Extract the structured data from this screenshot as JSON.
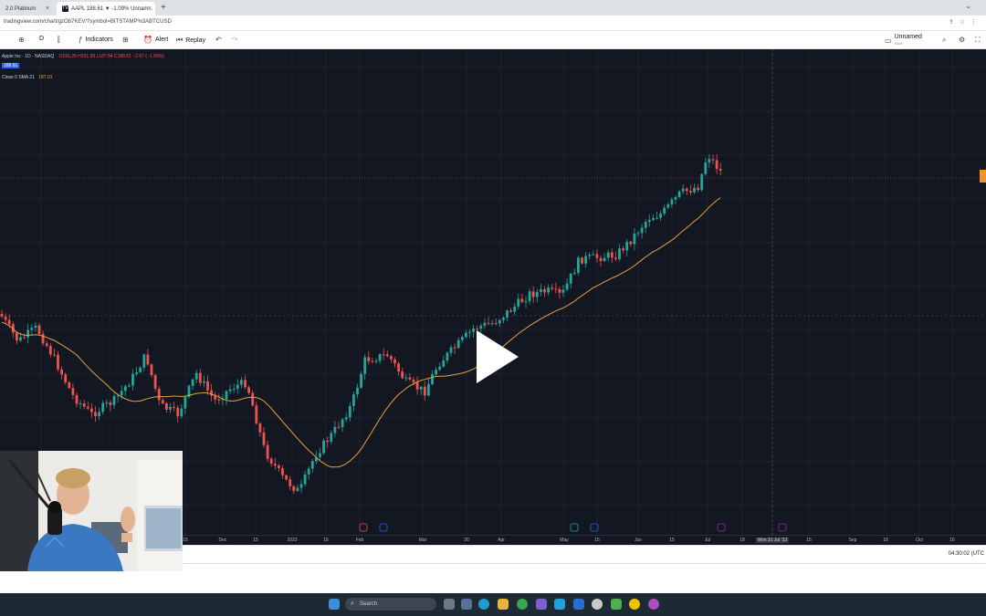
{
  "browser": {
    "tabs": [
      {
        "label": "2.0 Platinum",
        "active": false
      },
      {
        "label": "AAPL 188.61 ▼ -1.09% Unnam...",
        "active": true
      }
    ],
    "new_tab_icon": "plus-icon",
    "url": "tradingview.com/chart/gzOb7KEV/?symbol=BITSTAMP%3ABTCUSD"
  },
  "toolbar": {
    "interval": "D",
    "indicators_label": "Indicators",
    "alert_label": "Alert",
    "replay_label": "Replay",
    "layout_name": "Unnamed",
    "layout_sub": "Save"
  },
  "legend": {
    "symbol": "Apple Inc · 1D · NASDAQ",
    "ohlc": "O191.26 H191.99 L187.54 C188.61 −2.07 (−1.09%)",
    "price_tag": "188.61",
    "sma": "Close 0 SMA 21",
    "sma_value": "187.01"
  },
  "chart_data": {
    "type": "candlestick",
    "title": "",
    "xlabel": "",
    "ylabel": "",
    "x_ticks": [
      "15",
      "Dec",
      "15",
      "2023",
      "16",
      "Feb",
      "Mar",
      "20",
      "Apr",
      "May",
      "15",
      "Jun",
      "15",
      "Jul",
      "18",
      "Mon 31 Jul '23",
      "15",
      "Sep",
      "18",
      "Oct",
      "16"
    ],
    "highlighted_x_tick": "Mon 31 Jul '23",
    "up_color": "#26a69a",
    "down_color": "#ef5350",
    "sma_color": "#e9a13b",
    "series": [
      {
        "name": "Close 0 SMA 21",
        "type": "line"
      }
    ]
  },
  "status": {
    "clock": "04:30:02 (UTC"
  },
  "taskbar": {
    "search_placeholder": "Search"
  },
  "video": {
    "play_icon": "play-icon"
  }
}
